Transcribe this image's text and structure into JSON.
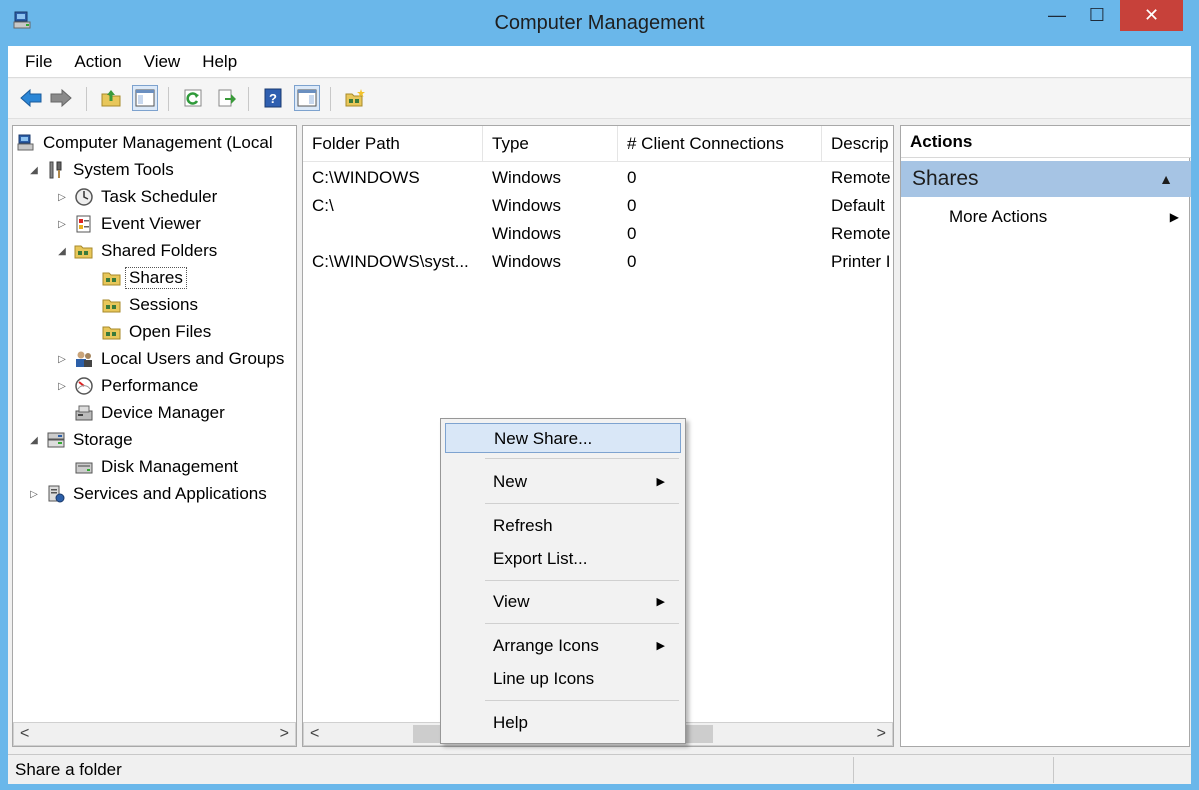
{
  "window": {
    "title": "Computer Management",
    "min_glyph": "—",
    "max_glyph": "☐",
    "close_glyph": "✕"
  },
  "menu": [
    "File",
    "Action",
    "View",
    "Help"
  ],
  "toolbar": {
    "icons": [
      "back-icon",
      "forward-icon",
      "up-folder-icon",
      "show-hide-tree-icon",
      "refresh-icon",
      "export-list-icon",
      "help-icon",
      "show-hide-action-pane-icon",
      "new-share-icon"
    ]
  },
  "tree": {
    "root": "Computer Management (Local",
    "system_tools": "System Tools",
    "task_scheduler": "Task Scheduler",
    "event_viewer": "Event Viewer",
    "shared_folders": "Shared Folders",
    "shares": "Shares",
    "sessions": "Sessions",
    "open_files": "Open Files",
    "local_users": "Local Users and Groups",
    "performance": "Performance",
    "device_manager": "Device Manager",
    "storage": "Storage",
    "disk_management": "Disk Management",
    "services": "Services and Applications"
  },
  "list": {
    "columns": [
      "Folder Path",
      "Type",
      "# Client Connections",
      "Descrip"
    ],
    "rows": [
      {
        "path": "C:\\WINDOWS",
        "type": "Windows",
        "connections": "0",
        "desc": "Remote"
      },
      {
        "path": "C:\\",
        "type": "Windows",
        "connections": "0",
        "desc": "Default"
      },
      {
        "path": "",
        "type": "Windows",
        "connections": "0",
        "desc": "Remote"
      },
      {
        "path": "C:\\WINDOWS\\syst...",
        "type": "Windows",
        "connections": "0",
        "desc": "Printer I"
      }
    ]
  },
  "actions": {
    "header": "Actions",
    "group": "Shares",
    "more": "More Actions"
  },
  "context_menu": {
    "new_share": "New Share...",
    "new": "New",
    "refresh": "Refresh",
    "export_list": "Export List...",
    "view": "View",
    "arrange_icons": "Arrange Icons",
    "line_up_icons": "Line up Icons",
    "help": "Help"
  },
  "status": {
    "text": "Share a folder"
  },
  "colors": {
    "titlebar": "#6ab7ea",
    "close_button": "#c7413a",
    "actions_group": "#a6c4e4",
    "highlight": "#d9e7f7"
  }
}
